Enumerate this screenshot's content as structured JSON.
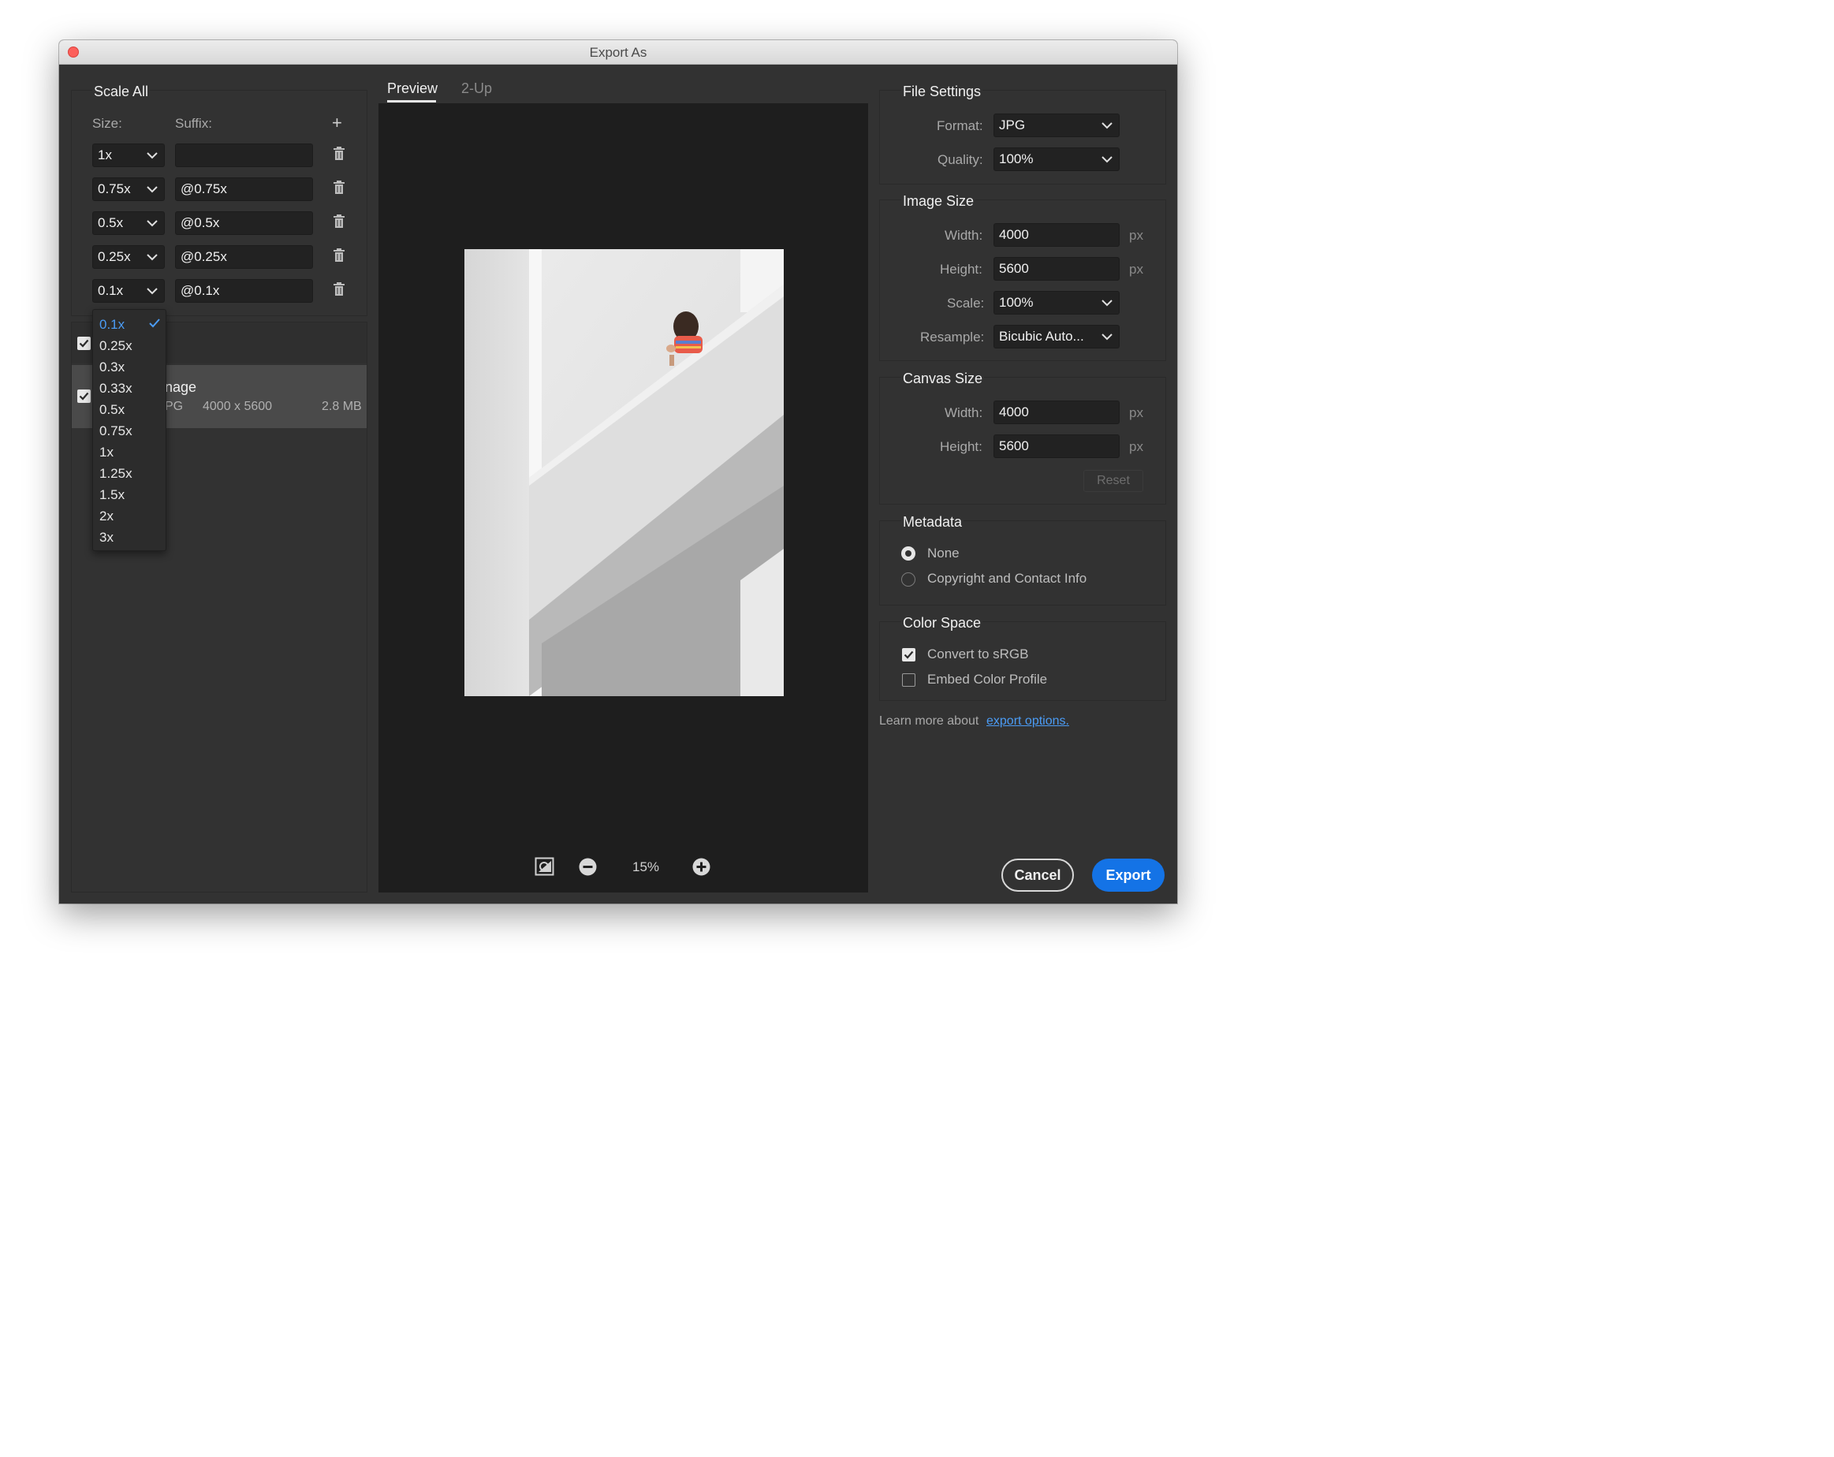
{
  "window": {
    "title": "Export As"
  },
  "scale_panel": {
    "title": "Scale All",
    "size_label": "Size:",
    "suffix_label": "Suffix:",
    "add_icon": "+",
    "rows": [
      {
        "size": "1x",
        "suffix": ""
      },
      {
        "size": "0.75x",
        "suffix": "@0.75x"
      },
      {
        "size": "0.5x",
        "suffix": "@0.5x"
      },
      {
        "size": "0.25x",
        "suffix": "@0.25x"
      },
      {
        "size": "0.1x",
        "suffix": "@0.1x"
      }
    ],
    "dropdown": {
      "selected": "0.1x",
      "options": [
        "0.1x",
        "0.25x",
        "0.3x",
        "0.33x",
        "0.5x",
        "0.75x",
        "1x",
        "1.25x",
        "1.5x",
        "2x",
        "3x"
      ]
    }
  },
  "asset_list": {
    "item_name_partial": "nage",
    "item_format_partial": "PG",
    "item_dimensions": "4000 x 5600",
    "item_size": "2.8 MB"
  },
  "preview": {
    "tabs": [
      "Preview",
      "2-Up"
    ],
    "active_tab": "Preview",
    "zoom": "15%"
  },
  "file_settings": {
    "title": "File Settings",
    "format_label": "Format:",
    "format_value": "JPG",
    "quality_label": "Quality:",
    "quality_value": "100%"
  },
  "image_size": {
    "title": "Image Size",
    "width_label": "Width:",
    "width_value": "4000",
    "height_label": "Height:",
    "height_value": "5600",
    "unit": "px",
    "scale_label": "Scale:",
    "scale_value": "100%",
    "resample_label": "Resample:",
    "resample_value": "Bicubic Auto..."
  },
  "canvas_size": {
    "title": "Canvas Size",
    "width_label": "Width:",
    "width_value": "4000",
    "height_label": "Height:",
    "height_value": "5600",
    "unit": "px",
    "reset_label": "Reset"
  },
  "metadata": {
    "title": "Metadata",
    "options": [
      "None",
      "Copyright and Contact Info"
    ],
    "selected": "None"
  },
  "color_space": {
    "title": "Color Space",
    "convert_label": "Convert to sRGB",
    "convert_checked": true,
    "embed_label": "Embed Color Profile",
    "embed_checked": false
  },
  "learn_more": {
    "text": "Learn more about",
    "link": "export options."
  },
  "actions": {
    "cancel": "Cancel",
    "export": "Export"
  },
  "colors": {
    "accent": "#1473e6",
    "link": "#4b9cf5",
    "selected_option": "#4b9cf5"
  }
}
